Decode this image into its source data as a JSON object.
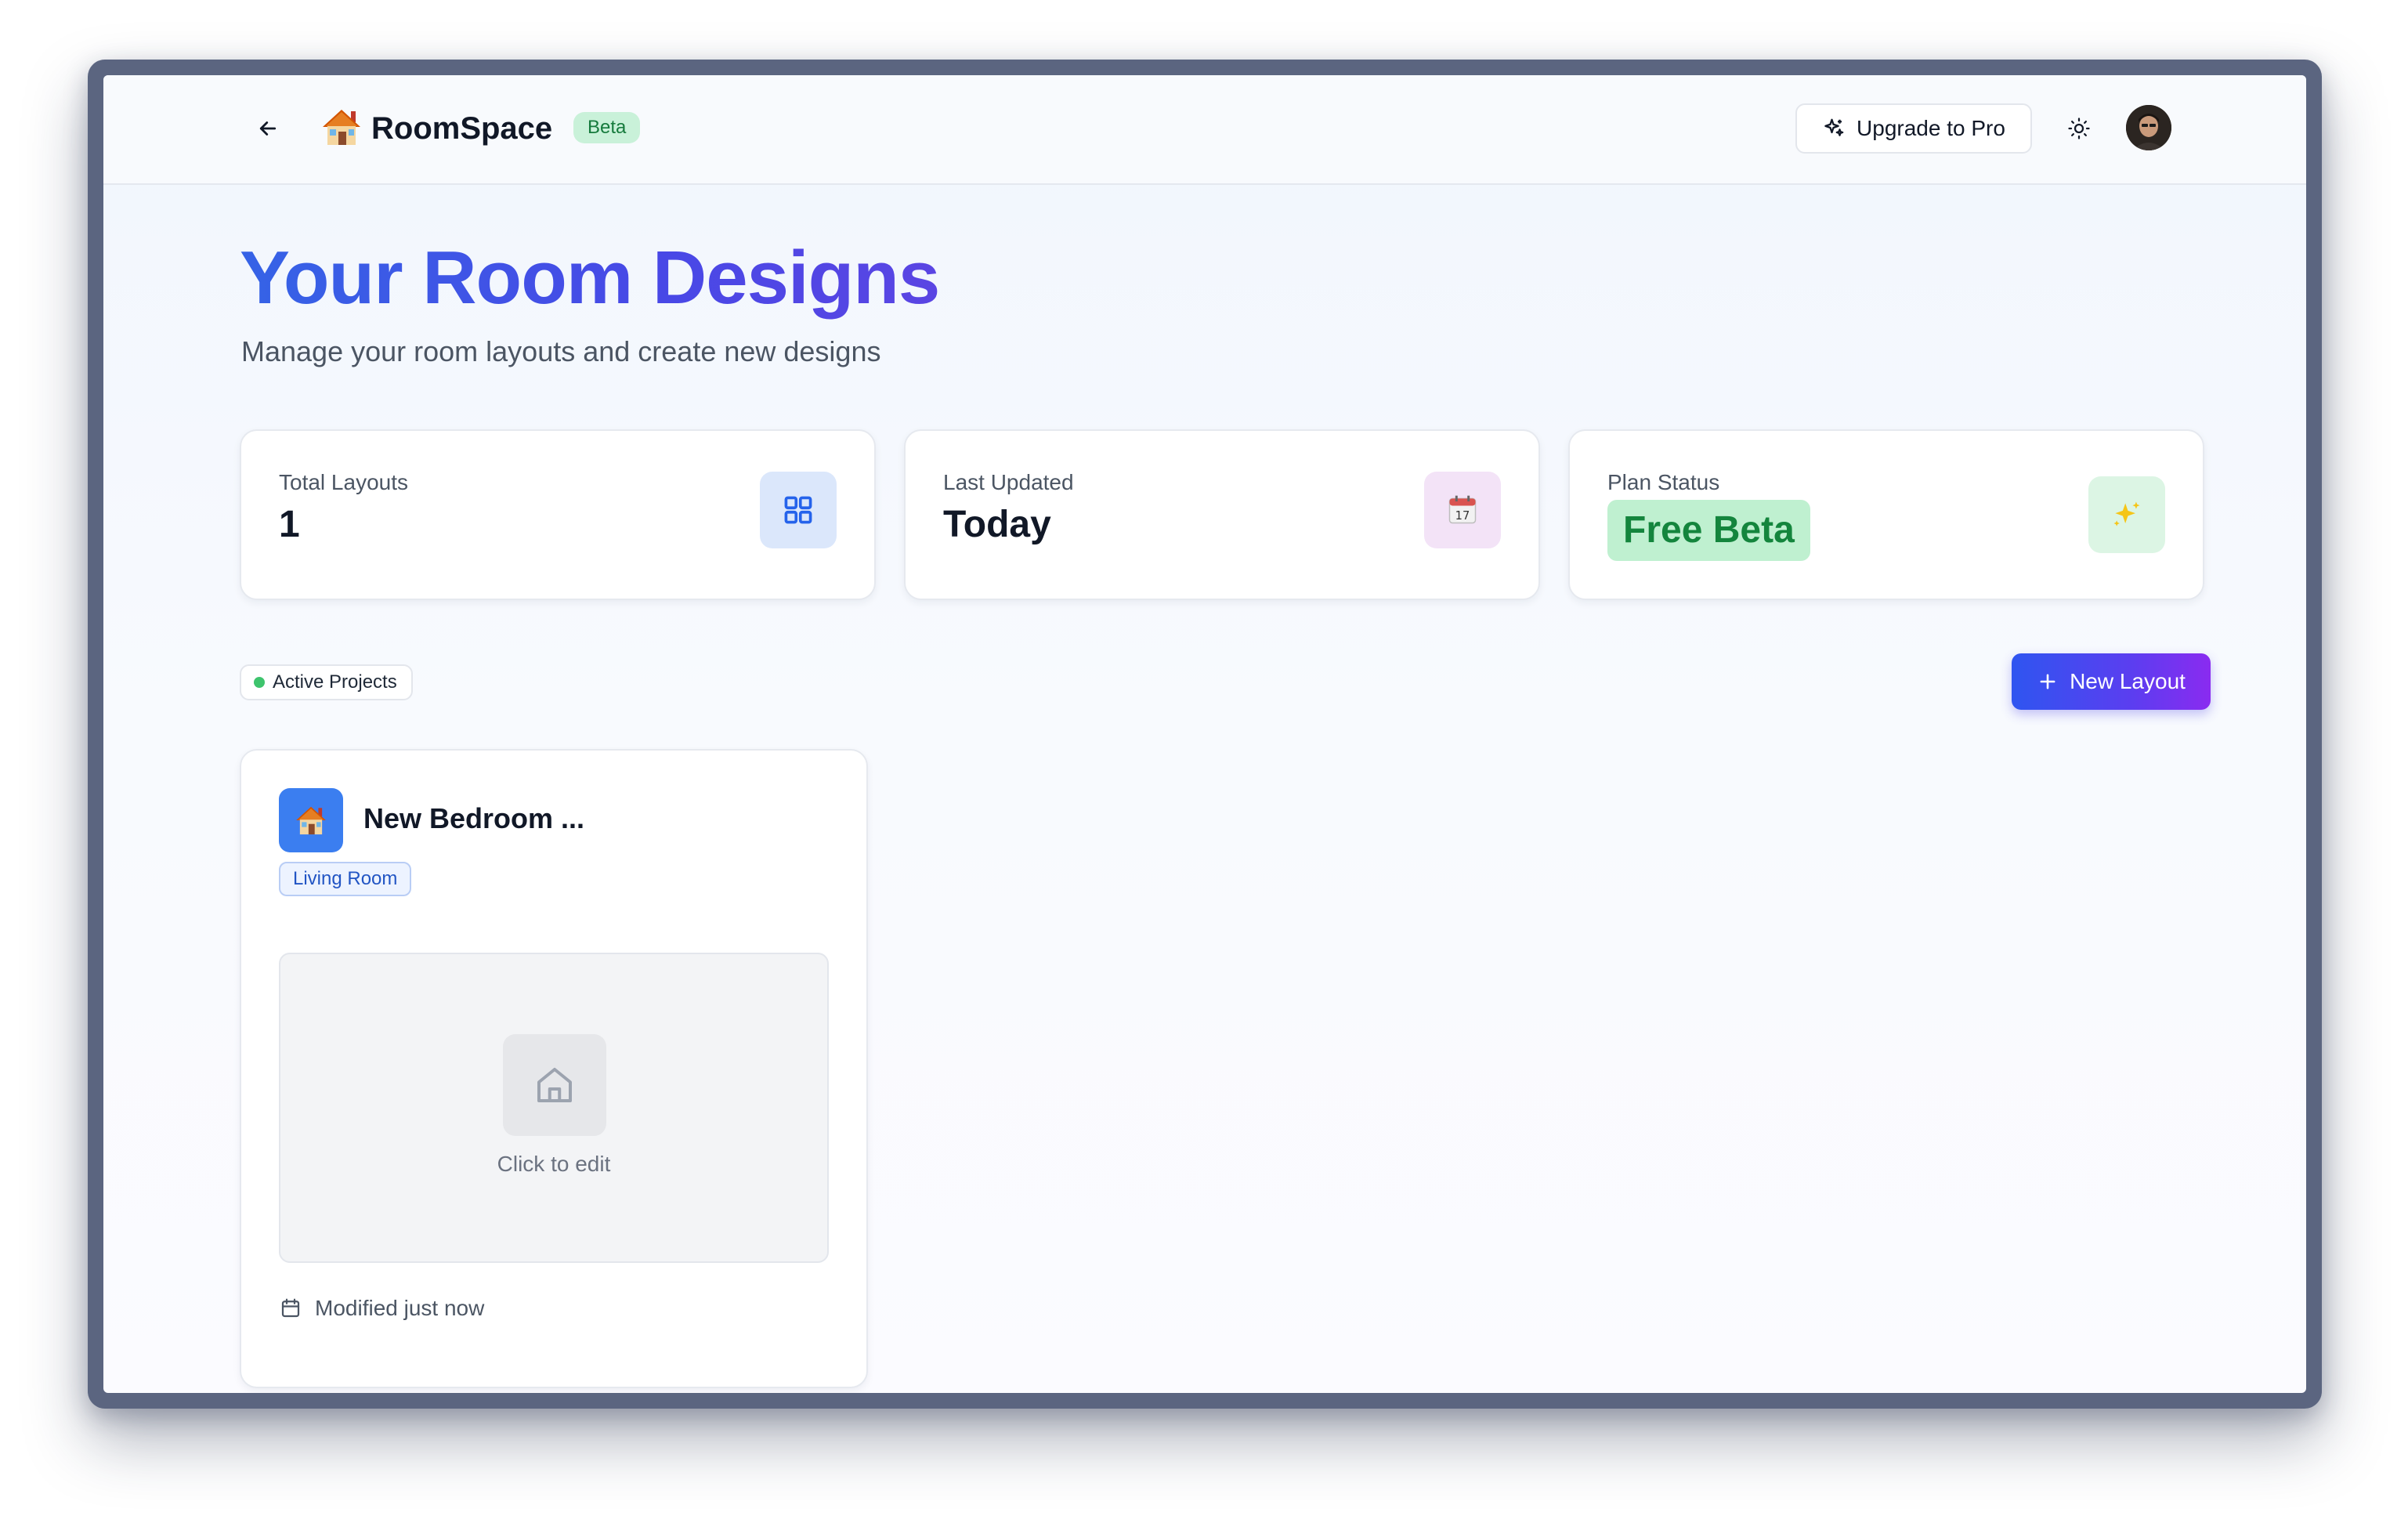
{
  "header": {
    "app_name": "RoomSpace",
    "badge": "Beta",
    "upgrade_label": "Upgrade to Pro",
    "icons": {
      "back": "arrow-left-icon",
      "logo": "house-icon",
      "upgrade": "sparkles-icon",
      "theme": "sun-icon",
      "avatar": "user-avatar"
    }
  },
  "main": {
    "title": "Your Room Designs",
    "subtitle": "Manage your room layouts and create new designs"
  },
  "stats": [
    {
      "label": "Total Layouts",
      "value": "1",
      "icon": "grid-icon",
      "color": "#dbe7fb"
    },
    {
      "label": "Last Updated",
      "value": "Today",
      "icon": "calendar-icon",
      "color": "#f3e3f7"
    },
    {
      "label": "Plan Status",
      "value": "Free Beta",
      "icon": "sparkles-icon",
      "color": "#dcf5e4"
    }
  ],
  "projects": {
    "filter_label": "Active Projects",
    "new_layout_label": "New Layout"
  },
  "layouts": [
    {
      "title": "New Bedroom ...",
      "tag": "Living Room",
      "preview_text": "Click to edit",
      "modified": "Modified just now"
    }
  ],
  "colors": {
    "accent": "#4848e6",
    "success": "#14853d",
    "button_gradient_start": "#2f55f0",
    "button_gradient_end": "#8a2bf0"
  }
}
